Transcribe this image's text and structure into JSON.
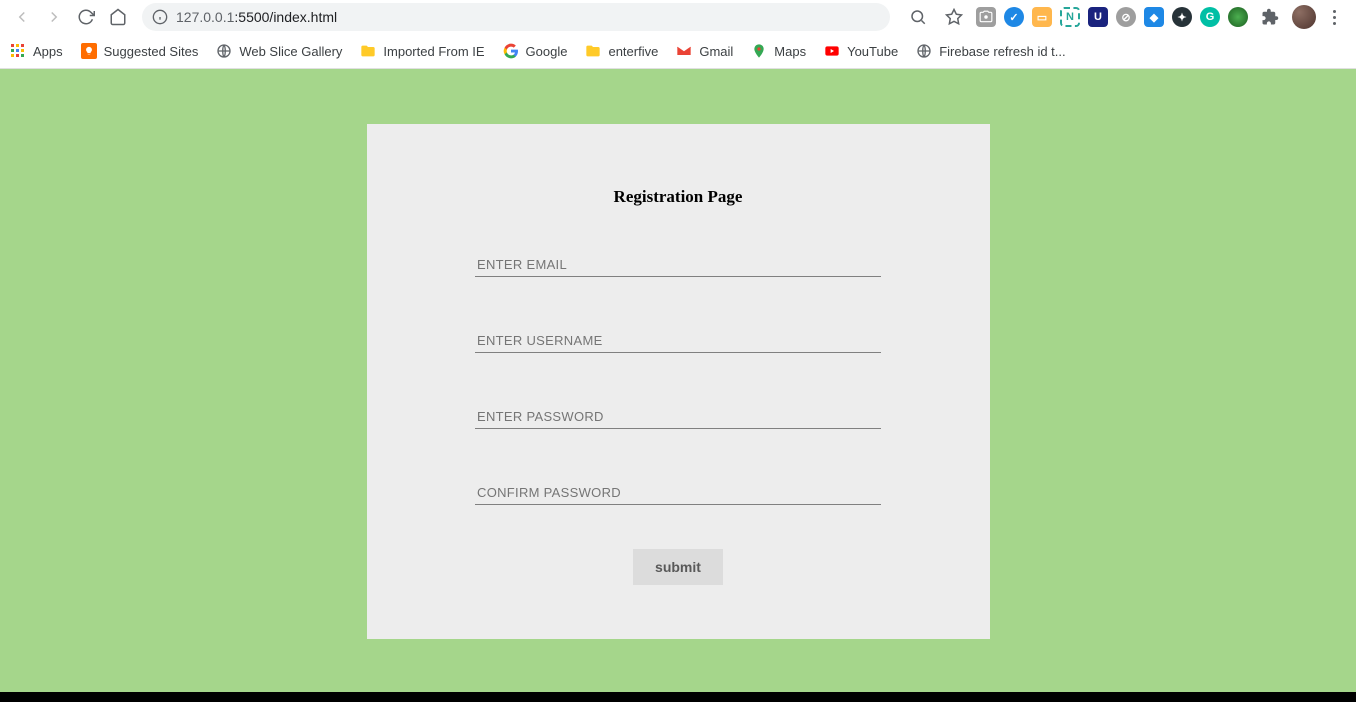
{
  "browser": {
    "url_host": "127.0.0.1",
    "url_port_path": ":5500/index.html"
  },
  "bookmarks": {
    "apps": "Apps",
    "suggested": "Suggested Sites",
    "webslice": "Web Slice Gallery",
    "imported": "Imported From IE",
    "google": "Google",
    "enterfive": "enterfive",
    "gmail": "Gmail",
    "maps": "Maps",
    "youtube": "YouTube",
    "firebase": "Firebase refresh id t..."
  },
  "form": {
    "title": "Registration Page",
    "email_placeholder": "ENTER EMAIL",
    "username_placeholder": "ENTER USERNAME",
    "password_placeholder": "ENTER PASSWORD",
    "confirm_placeholder": "CONFIRM PASSWORD",
    "submit_label": "submit"
  }
}
